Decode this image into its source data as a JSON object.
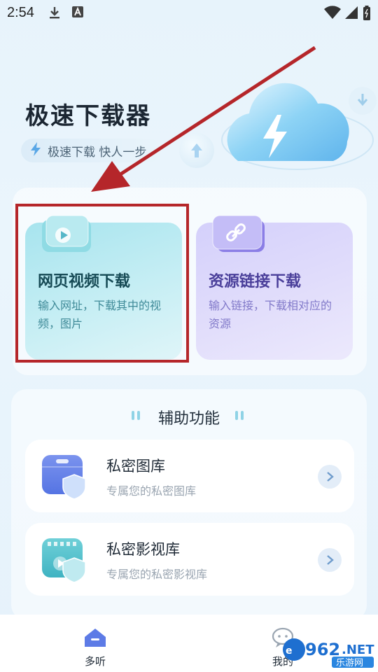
{
  "status_bar": {
    "time": "2:54"
  },
  "header": {
    "app_title": "极速下载器",
    "slogan": "极速下载 快人一步"
  },
  "features": [
    {
      "title": "网页视频下载",
      "desc": "输入网址，下载其中的视频，图片"
    },
    {
      "title": "资源链接下载",
      "desc": "输入链接，下载相对应的资源"
    }
  ],
  "aux_section": {
    "title": "辅助功能",
    "items": [
      {
        "title": "私密图库",
        "subtitle": "专属您的私密图库"
      },
      {
        "title": "私密影视库",
        "subtitle": "专属您的私密影视库"
      }
    ]
  },
  "bottom_nav": [
    {
      "label": "多听",
      "icon": "home-icon"
    },
    {
      "label": "我的",
      "icon": "chat-bubble-icon"
    }
  ],
  "watermark": {
    "brand": "962.NET",
    "sub": "乐游网"
  },
  "colors": {
    "accent_teal": "#a7e4ee",
    "accent_purple": "#d4d0fb",
    "highlight_red": "#b5262a"
  }
}
